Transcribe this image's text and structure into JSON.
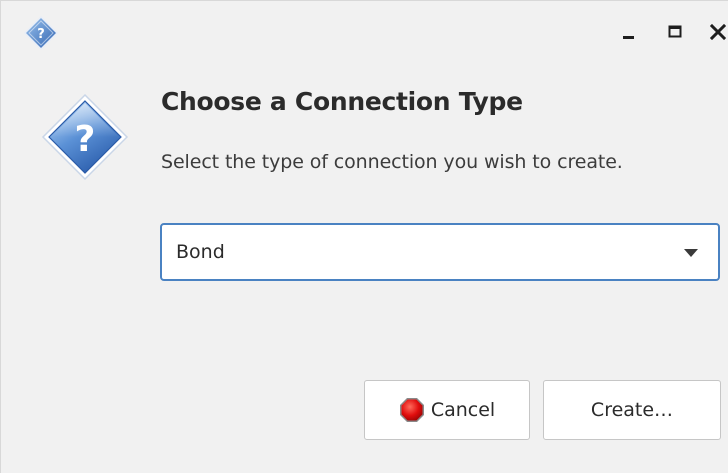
{
  "window": {
    "app_icon": "question-diamond-icon",
    "controls": {
      "minimize_icon": "minimize-icon",
      "maximize_icon": "maximize-icon",
      "close_icon": "close-icon"
    }
  },
  "dialog": {
    "icon": "question-diamond-icon",
    "heading": "Choose a Connection Type",
    "subtitle": "Select the type of connection you wish to create.",
    "connection_type": {
      "selected": "Bond"
    },
    "buttons": {
      "cancel_label": "Cancel",
      "cancel_icon": "stop-icon",
      "create_label": "Create…"
    }
  },
  "colors": {
    "window_bg": "#f1f1f1",
    "focus_border": "#4a82c2",
    "icon_blue": "#3f78c4",
    "stop_red": "#d01010"
  }
}
